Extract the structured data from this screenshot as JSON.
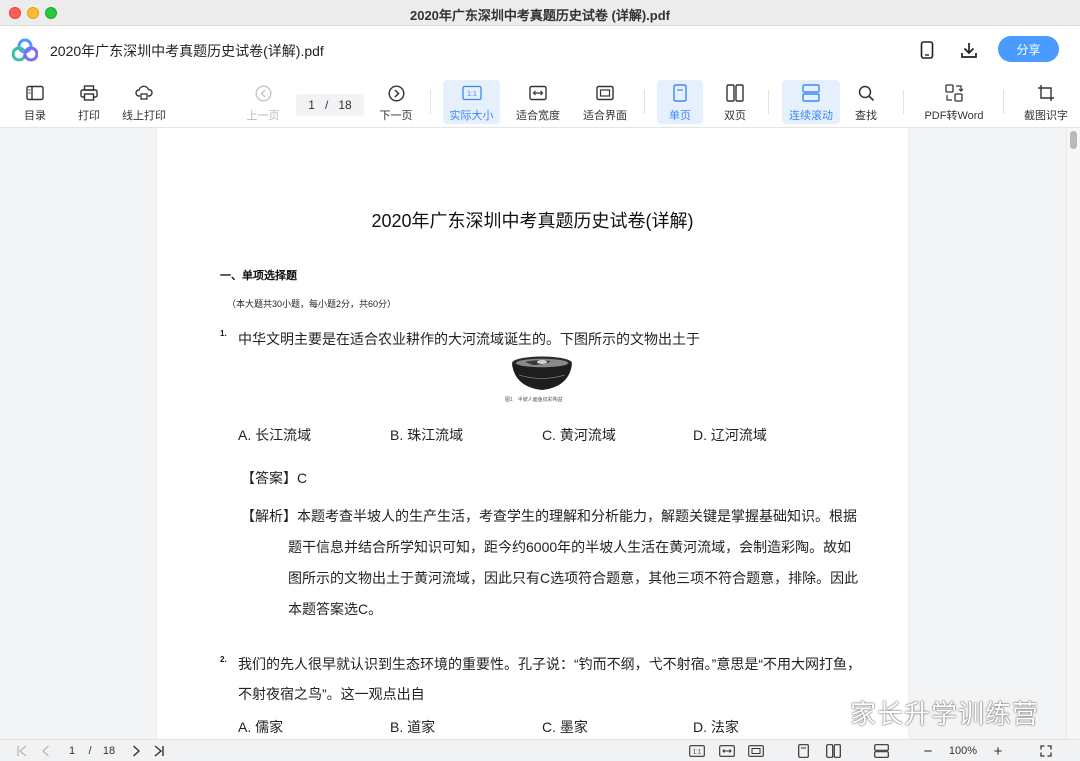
{
  "window": {
    "title": "2020年广东深圳中考真题历史试卷 (详解).pdf"
  },
  "header": {
    "doc_title": "2020年广东深圳中考真题历史试卷(详解).pdf",
    "share_label": "分享",
    "accent_color": "#4a9bff"
  },
  "toolbar": {
    "toc": "目录",
    "print": "打印",
    "online_print": "线上打印",
    "prev_page": "上一页",
    "current_page": "1",
    "page_sep": "/",
    "total_pages": "18",
    "next_page": "下一页",
    "actual_size": "实际大小",
    "fit_width": "适合宽度",
    "fit_page": "适合界面",
    "single_page": "单页",
    "double_page": "双页",
    "continuous_scroll": "连续滚动",
    "find": "查找",
    "pdf_to_word": "PDF转Word",
    "screenshot_ocr": "截图识字",
    "actual_size_icon_text": "1:1"
  },
  "document": {
    "title": "2020年广东深圳中考真题历史试卷(详解)",
    "section": "一、单项选择题",
    "note": "（本大题共30小题，每小题2分，共60分）",
    "q1": {
      "num": "1.",
      "text": "中华文明主要是在适合农业耕作的大河流域诞生的。下图所示的文物出土于",
      "figure_caption": "图1　半坡人面鱼纹彩陶盆",
      "options": [
        "A. 长江流域",
        "B. 珠江流域",
        "C. 黄河流域",
        "D. 辽河流域"
      ],
      "answer": "【答案】C",
      "analysis_label": "【解析】",
      "analysis_lines": [
        "本题考查半坡人的生产生活，考查学生的理解和分析能力，解题关键是掌握基础知识。根据",
        "题干信息并结合所学知识可知，距今约6000年的半坡人生活在黄河流域，会制造彩陶。故如",
        "图所示的文物出土于黄河流域，因此只有C选项符合题意，其他三项不符合题意，排除。因此",
        "本题答案选C。"
      ]
    },
    "q2": {
      "num": "2.",
      "lines": [
        "我们的先人很早就认识到生态环境的重要性。孔子说：“钓而不纲，弋不射宿。”意思是“不用大网打鱼，",
        "不射夜宿之鸟”。这一观点出自"
      ],
      "options": [
        "A. 儒家",
        "B. 道家",
        "C. 墨家",
        "D. 法家"
      ]
    }
  },
  "watermark": {
    "text": "家长升学训练营"
  },
  "statusbar": {
    "current_page": "1",
    "page_sep": "/",
    "total_pages": "18",
    "zoom": "100%",
    "actual_size_icon_text": "1:1",
    "zoom_out": "−",
    "zoom_in": "+"
  }
}
